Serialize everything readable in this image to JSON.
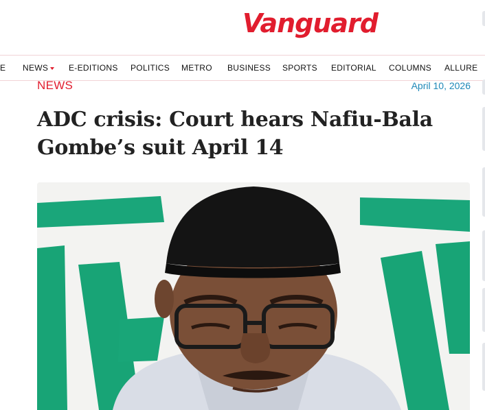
{
  "site": {
    "logo_text": "Vanguard",
    "brand_color": "#e11d2e"
  },
  "nav": {
    "items": [
      {
        "label": "E"
      },
      {
        "label": "NEWS",
        "has_dropdown": true
      },
      {
        "label": "E-EDITIONS"
      },
      {
        "label": "POLITICS"
      },
      {
        "label": "METRO"
      },
      {
        "label": "BUSINESS"
      },
      {
        "label": "SPORTS"
      },
      {
        "label": "EDITORIAL"
      },
      {
        "label": "COLUMNS"
      },
      {
        "label": "ALLURE"
      }
    ]
  },
  "article": {
    "category": "NEWS",
    "date": "April 10, 2026",
    "headline": "ADC crisis: Court hears Nafiu-Bala Gombe’s suit April 14",
    "image_icon": "article-photo"
  }
}
